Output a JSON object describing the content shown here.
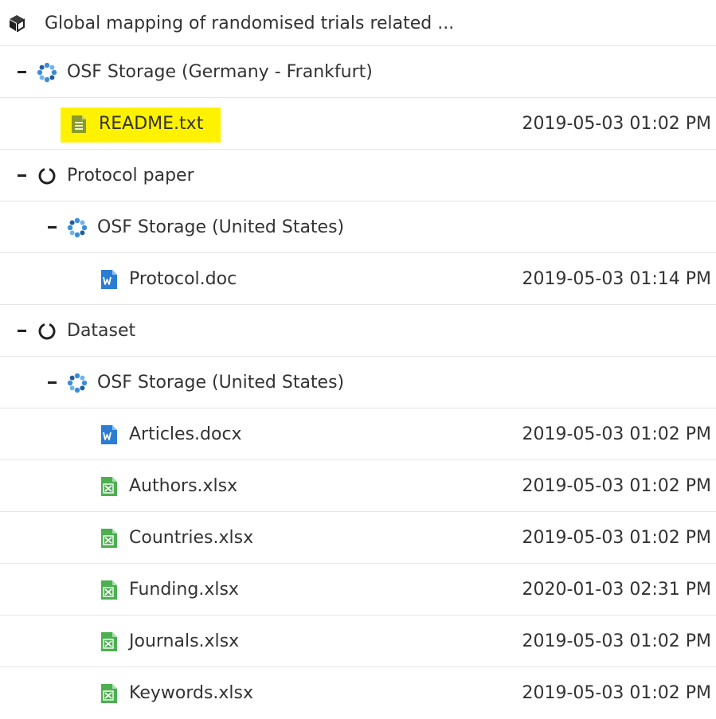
{
  "project": {
    "title": "Global mapping of randomised trials related ...",
    "icon": "cube-icon"
  },
  "tree": [
    {
      "kind": "storage",
      "label": "OSF Storage (Germany - Frankfurt)",
      "icon": "osf-storage-icon"
    },
    {
      "kind": "file",
      "label": "README.txt",
      "date": "2019-05-03 01:02 PM",
      "icon": "txt-file-icon",
      "highlighted": true
    },
    {
      "kind": "component",
      "label": "Protocol paper",
      "icon": "component-circle-icon"
    },
    {
      "kind": "storage",
      "label": "OSF Storage (United States)",
      "icon": "osf-storage-icon"
    },
    {
      "kind": "file",
      "label": "Protocol.doc",
      "date": "2019-05-03 01:14 PM",
      "icon": "word-file-icon"
    },
    {
      "kind": "component",
      "label": "Dataset",
      "icon": "component-circle-icon"
    },
    {
      "kind": "storage",
      "label": "OSF Storage (United States)",
      "icon": "osf-storage-icon"
    },
    {
      "kind": "file",
      "label": "Articles.docx",
      "date": "2019-05-03 01:02 PM",
      "icon": "word-file-icon"
    },
    {
      "kind": "file",
      "label": "Authors.xlsx",
      "date": "2019-05-03 01:02 PM",
      "icon": "excel-file-icon"
    },
    {
      "kind": "file",
      "label": "Countries.xlsx",
      "date": "2019-05-03 01:02 PM",
      "icon": "excel-file-icon"
    },
    {
      "kind": "file",
      "label": "Funding.xlsx",
      "date": "2020-01-03 02:31 PM",
      "icon": "excel-file-icon"
    },
    {
      "kind": "file",
      "label": "Journals.xlsx",
      "date": "2019-05-03 01:02 PM",
      "icon": "excel-file-icon"
    },
    {
      "kind": "file",
      "label": "Keywords.xlsx",
      "date": "2019-05-03 01:02 PM",
      "icon": "excel-file-icon"
    }
  ],
  "colors": {
    "highlight": "#fff200",
    "word_blue": "#2b7cd3",
    "excel_green": "#4caf50",
    "txt_olive": "#8a9a2b",
    "osf_blue": "#3c8dd9",
    "divider": "#e6e6e6"
  }
}
